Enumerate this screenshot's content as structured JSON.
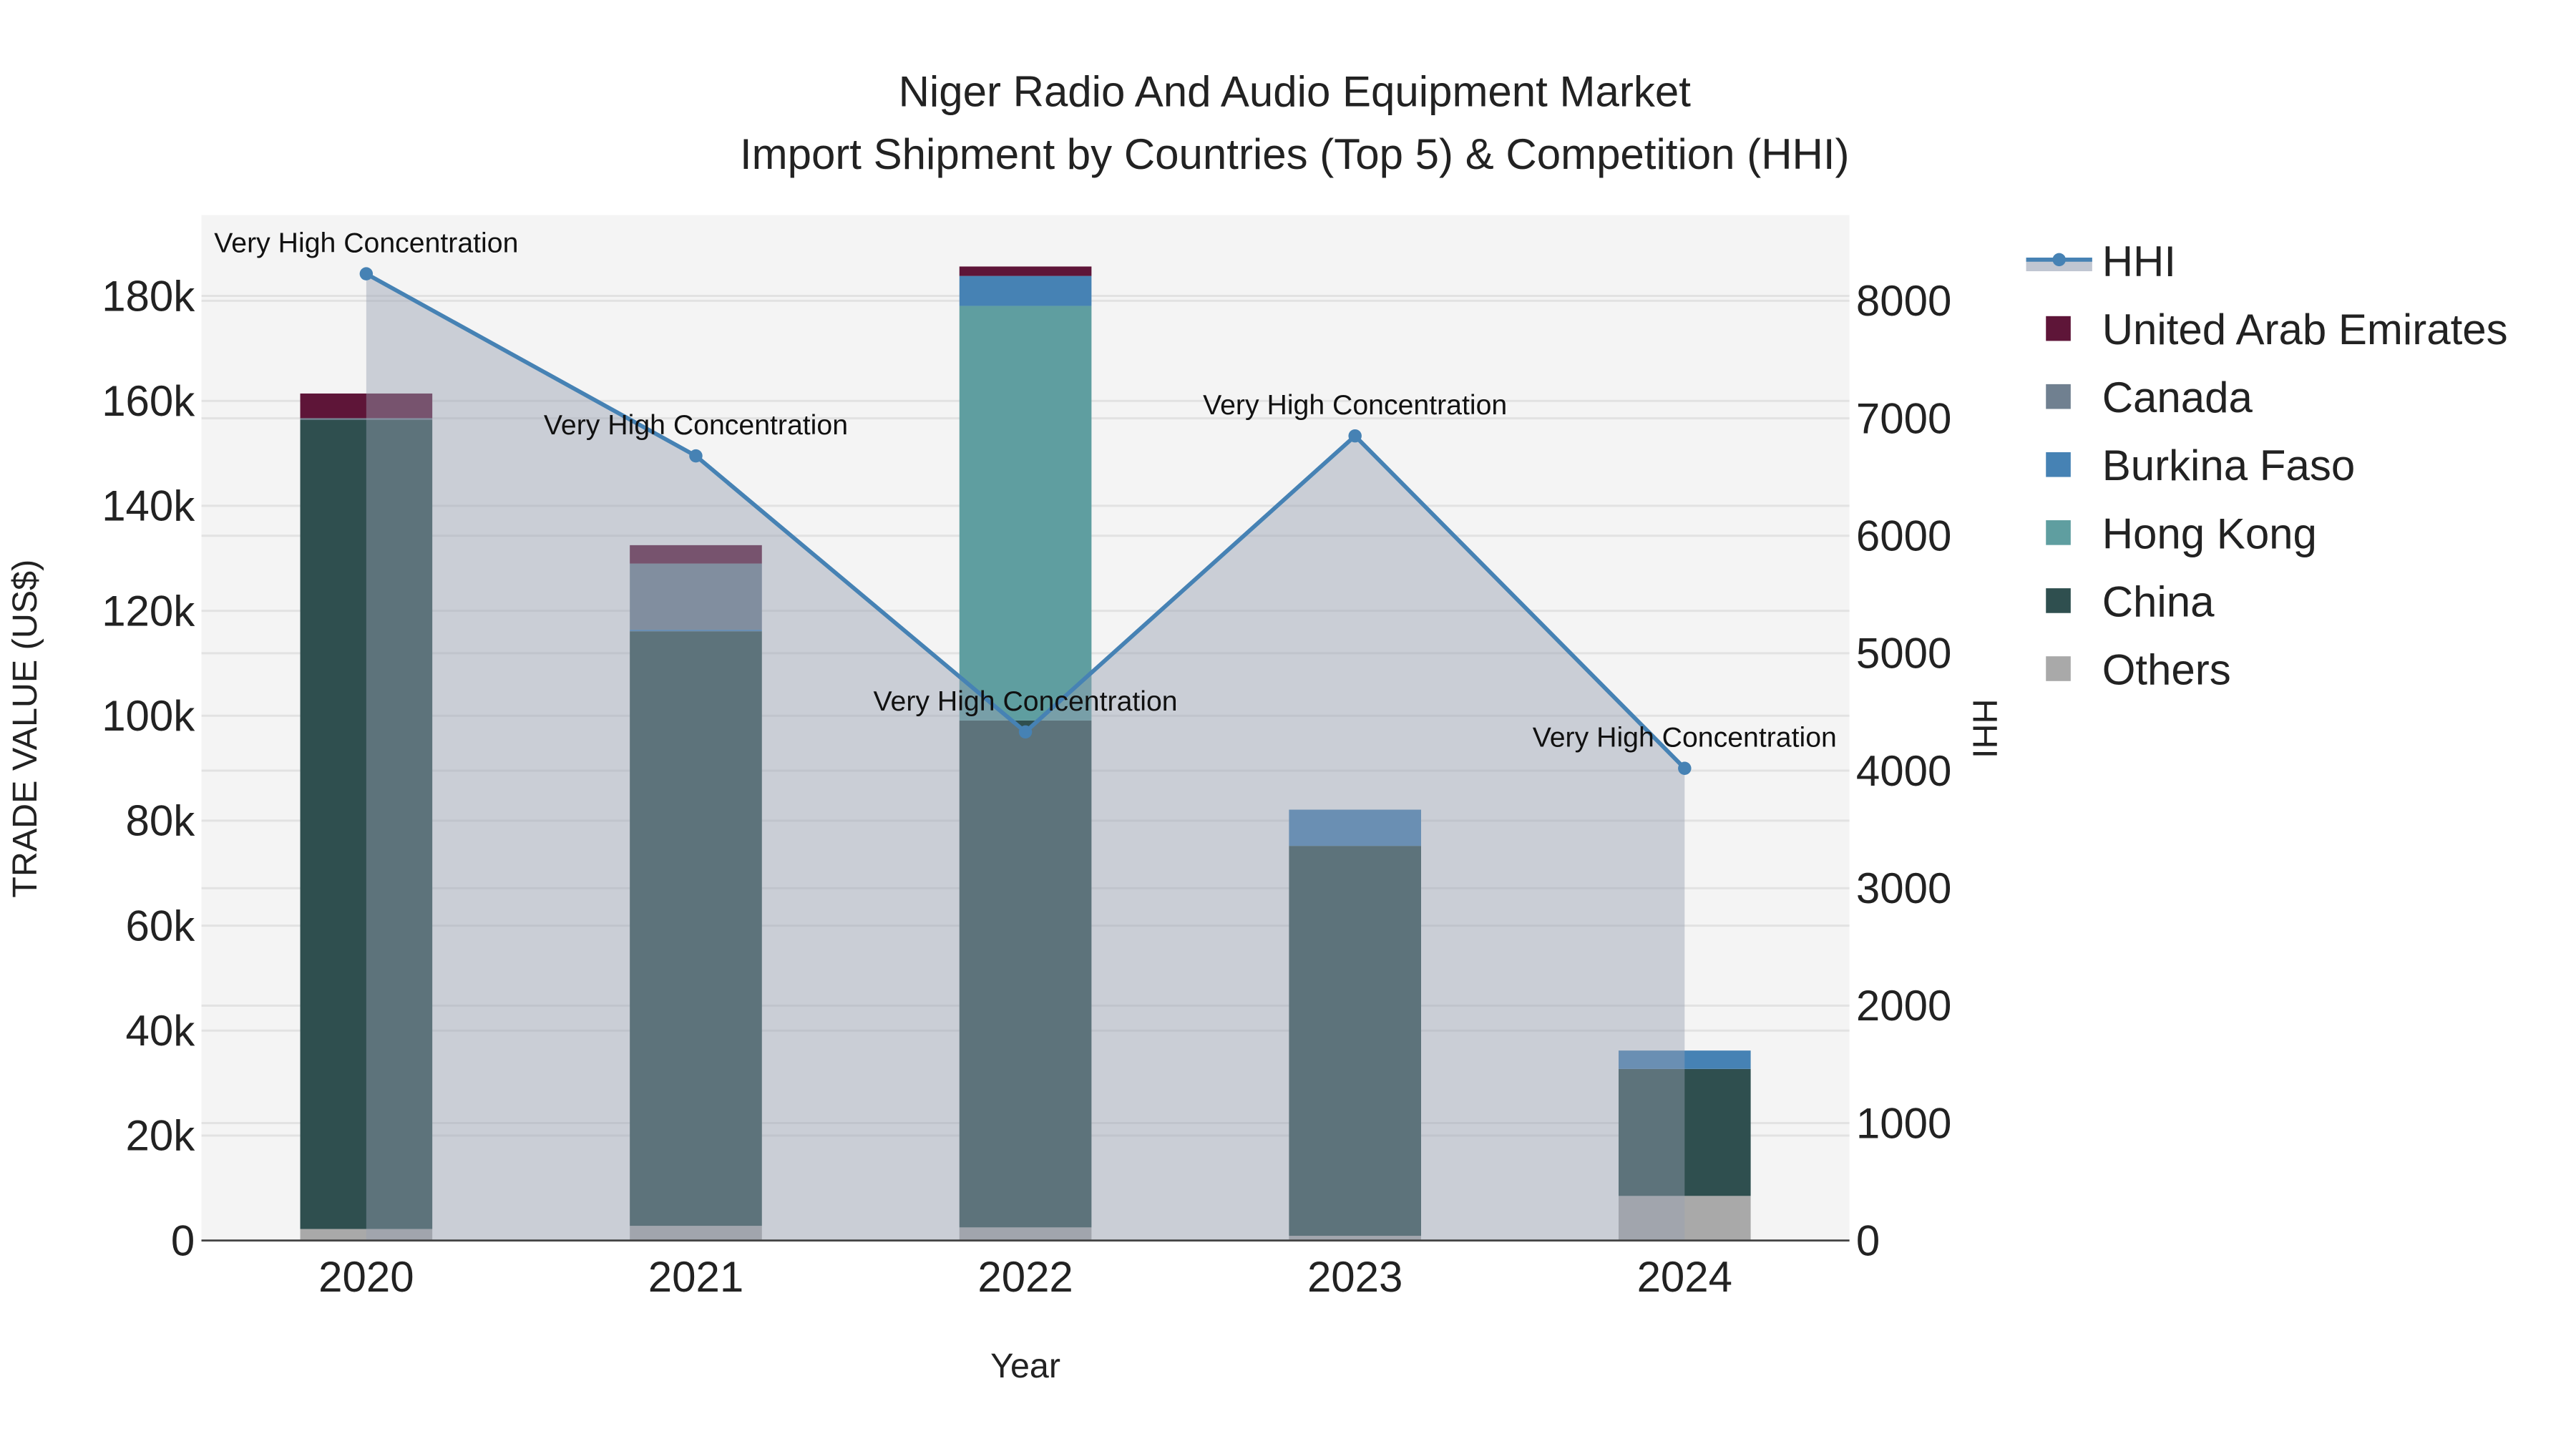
{
  "chart_data": {
    "type": "bar",
    "title_line1": "Niger Radio And Audio Equipment Market",
    "title_line2": "Import Shipment by Countries (Top 5) & Competition (HHI)",
    "xlabel": "Year",
    "ylabel": "TRADE VALUE (US$)",
    "y2label": "HHI",
    "categories": [
      "2020",
      "2021",
      "2022",
      "2023",
      "2024"
    ],
    "ylim": [
      0,
      195400
    ],
    "y2lim": [
      0,
      8730
    ],
    "yticks": [
      0,
      20000,
      40000,
      60000,
      80000,
      100000,
      120000,
      140000,
      160000,
      180000
    ],
    "ytick_labels": [
      "0",
      "20k",
      "40k",
      "60k",
      "80k",
      "100k",
      "120k",
      "140k",
      "160k",
      "180k"
    ],
    "y2ticks": [
      0,
      1000,
      2000,
      3000,
      4000,
      5000,
      6000,
      7000,
      8000
    ],
    "y2tick_labels": [
      "0",
      "1000",
      "2000",
      "3000",
      "4000",
      "5000",
      "6000",
      "7000",
      "8000"
    ],
    "grid": true,
    "legend_placement": "right",
    "series": [
      {
        "name": "Others",
        "color": "#A9A9A9",
        "values": [
          2200,
          2800,
          2500,
          900,
          8500
        ]
      },
      {
        "name": "China",
        "color": "#2F4F4F",
        "values": [
          154200,
          113300,
          96600,
          74300,
          24200
        ]
      },
      {
        "name": "Hong Kong",
        "color": "#5F9EA0",
        "values": [
          0,
          0,
          79000,
          0,
          0
        ]
      },
      {
        "name": "Burkina Faso",
        "color": "#4682B4",
        "values": [
          0,
          300,
          5700,
          6900,
          3500
        ]
      },
      {
        "name": "Canada",
        "color": "#708090",
        "values": [
          300,
          12600,
          0,
          0,
          0
        ]
      },
      {
        "name": "United Arab Emirates",
        "color": "#5E1538",
        "values": [
          4700,
          3500,
          1800,
          0,
          0
        ]
      }
    ],
    "legend_order": [
      "HHI",
      "United Arab Emirates",
      "Canada",
      "Burkina Faso",
      "Hong Kong",
      "China",
      "Others"
    ],
    "hhi": {
      "name": "HHI",
      "color": "#4682B4",
      "values": [
        8230,
        6680,
        4330,
        6850,
        4020
      ],
      "annotations": [
        "Very High Concentration",
        "Very High Concentration",
        "Very High Concentration",
        "Very High Concentration",
        "Very High Concentration"
      ]
    }
  }
}
